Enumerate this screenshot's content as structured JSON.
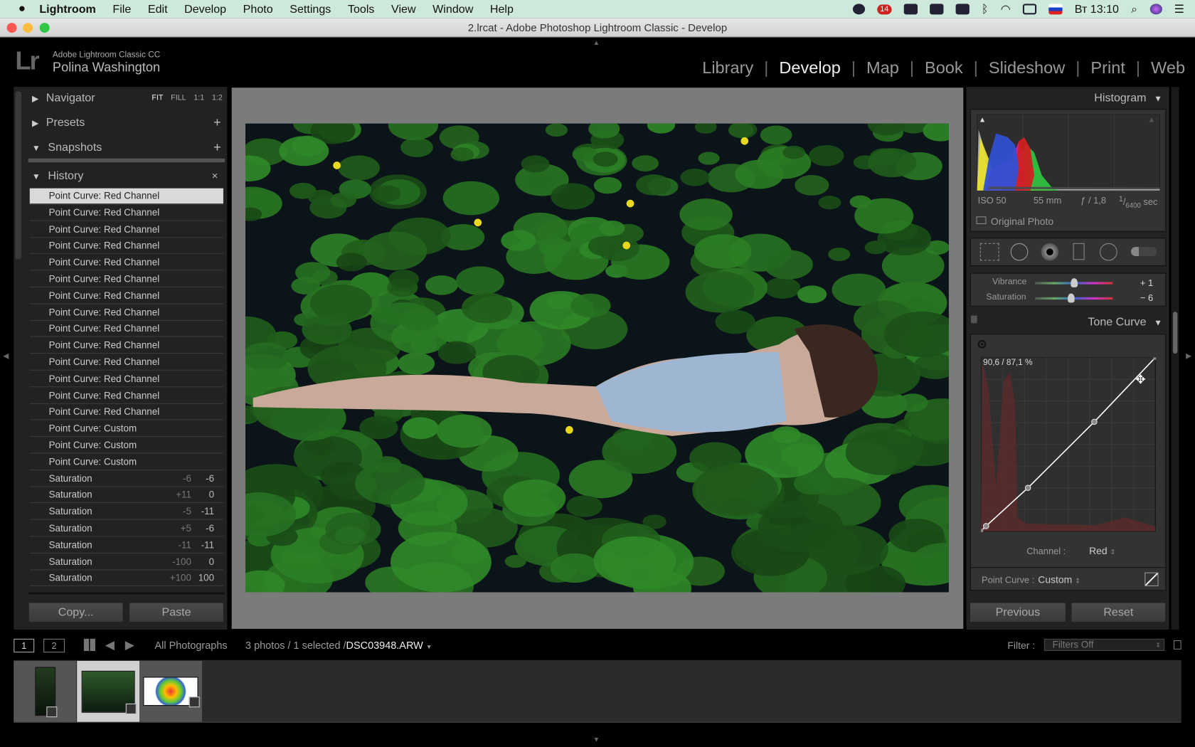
{
  "menubar": {
    "app": "Lightroom",
    "items": [
      "File",
      "Edit",
      "Develop",
      "Photo",
      "Settings",
      "Tools",
      "View",
      "Window",
      "Help"
    ],
    "badge": "14",
    "clock": "Вт 13:10"
  },
  "window": {
    "title": "2.lrcat - Adobe Photoshop Lightroom Classic - Develop"
  },
  "identity": {
    "product": "Adobe Lightroom Classic CC",
    "user": "Polina Washington",
    "logo": "Lr"
  },
  "modules": [
    {
      "label": "Library"
    },
    {
      "label": "Develop",
      "active": true
    },
    {
      "label": "Map"
    },
    {
      "label": "Book"
    },
    {
      "label": "Slideshow"
    },
    {
      "label": "Print"
    },
    {
      "label": "Web"
    }
  ],
  "left": {
    "navigator": {
      "label": "Navigator",
      "zoom": [
        "FIT",
        "FILL",
        "1:1",
        "1:2"
      ]
    },
    "presets": {
      "label": "Presets"
    },
    "snapshots": {
      "label": "Snapshots"
    },
    "history": {
      "label": "History",
      "items": [
        {
          "name": "Point Curve: Red Channel",
          "selected": true
        },
        {
          "name": "Point Curve: Red Channel"
        },
        {
          "name": "Point Curve: Red Channel"
        },
        {
          "name": "Point Curve: Red Channel"
        },
        {
          "name": "Point Curve: Red Channel"
        },
        {
          "name": "Point Curve: Red Channel"
        },
        {
          "name": "Point Curve: Red Channel"
        },
        {
          "name": "Point Curve: Red Channel"
        },
        {
          "name": "Point Curve: Red Channel"
        },
        {
          "name": "Point Curve: Red Channel"
        },
        {
          "name": "Point Curve: Red Channel"
        },
        {
          "name": "Point Curve: Red Channel"
        },
        {
          "name": "Point Curve: Red Channel"
        },
        {
          "name": "Point Curve: Red Channel"
        },
        {
          "name": "Point Curve: Custom"
        },
        {
          "name": "Point Curve: Custom"
        },
        {
          "name": "Point Curve: Custom"
        },
        {
          "name": "Saturation",
          "delta": "-6",
          "value": "-6"
        },
        {
          "name": "Saturation",
          "delta": "+11",
          "value": "0"
        },
        {
          "name": "Saturation",
          "delta": "-5",
          "value": "-11"
        },
        {
          "name": "Saturation",
          "delta": "+5",
          "value": "-6"
        },
        {
          "name": "Saturation",
          "delta": "-11",
          "value": "-11"
        },
        {
          "name": "Saturation",
          "delta": "-100",
          "value": "0"
        },
        {
          "name": "Saturation",
          "delta": "+100",
          "value": "100"
        }
      ]
    },
    "copy": "Copy...",
    "paste": "Paste"
  },
  "right": {
    "histogram": {
      "label": "Histogram",
      "iso": "ISO 50",
      "focal": "55 mm",
      "aperture": "ƒ / 1,8",
      "shutter_num": "1",
      "shutter_den": "6400",
      "shutter_unit": "sec",
      "original_photo": "Original Photo",
      "original_checked": false
    },
    "basic": {
      "vibrance_label": "Vibrance",
      "vibrance": "+ 1",
      "vibrance_value": 1,
      "saturation_label": "Saturation",
      "saturation": "− 6",
      "saturation_value": -6
    },
    "tone_curve": {
      "label": "Tone Curve",
      "readout": "90,6 / 87,1 %",
      "channel_label": "Channel :",
      "channel": "Red",
      "point_curve_label": "Point Curve :",
      "point_curve": "Custom",
      "points": [
        [
          0,
          0
        ],
        [
          3,
          3
        ],
        [
          27,
          25
        ],
        [
          65,
          63
        ],
        [
          100,
          100
        ]
      ]
    },
    "previous": "Previous",
    "reset": "Reset"
  },
  "filmstrip": {
    "source": "All Photographs",
    "count": "3 photos / 1 selected /",
    "filename": "DSC03948.ARW",
    "filter_label": "Filter :",
    "filter": "Filters Off",
    "view1": "1",
    "view2": "2",
    "selected_index": 1
  }
}
